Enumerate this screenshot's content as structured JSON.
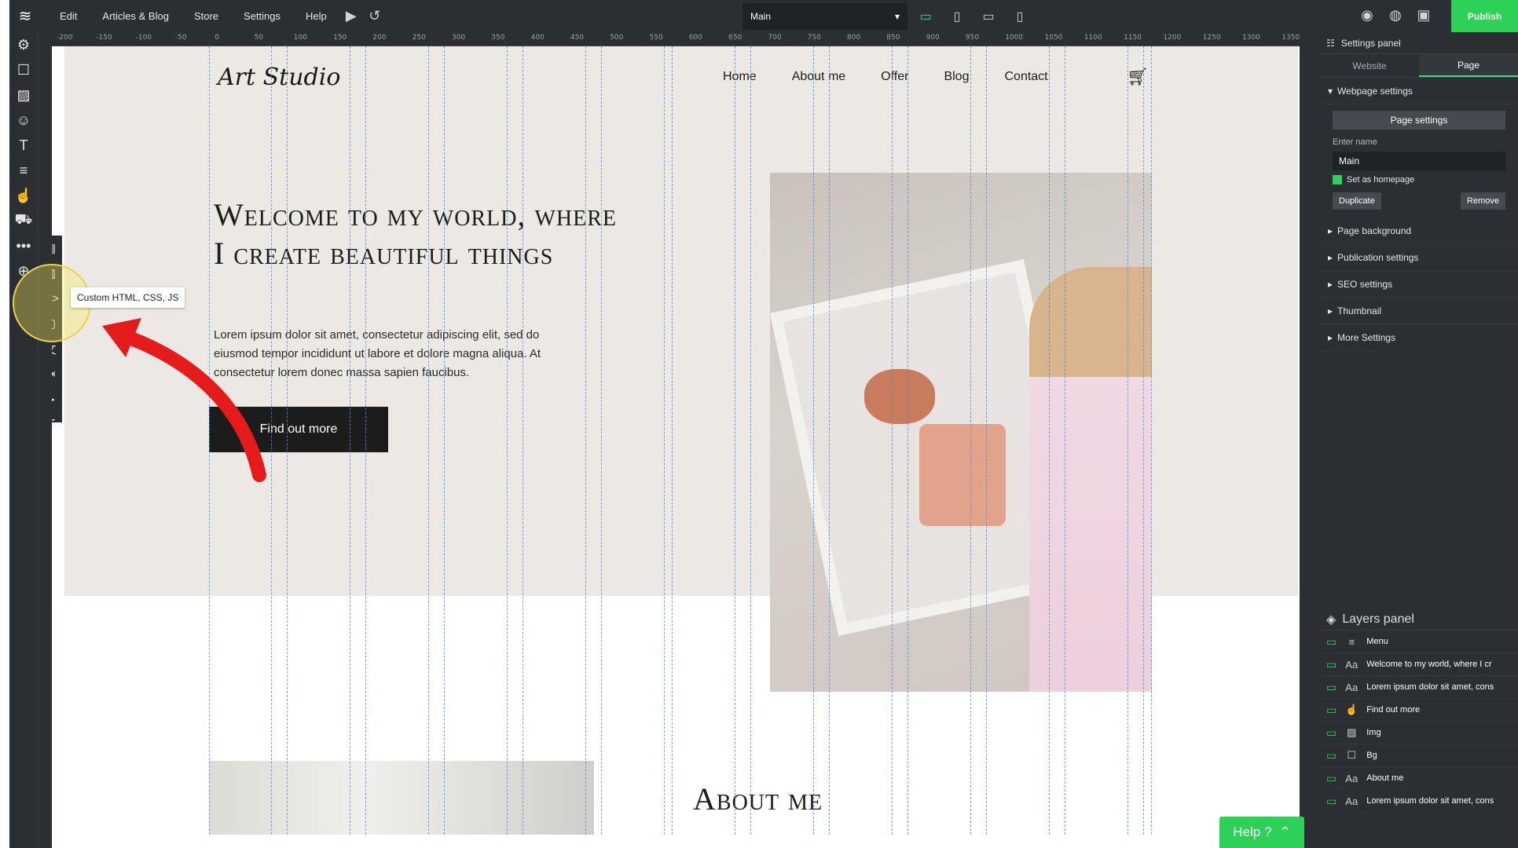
{
  "topbar": {
    "menu": [
      "Edit",
      "Articles & Blog",
      "Store",
      "Settings",
      "Help"
    ],
    "page_select": "Main",
    "publish_label": "Publish"
  },
  "ruler": {
    "ticks": [
      "-200",
      "-150",
      "-100",
      "-50",
      "0",
      "50",
      "100",
      "150",
      "200",
      "250",
      "300",
      "350",
      "400",
      "450",
      "500",
      "550",
      "600",
      "650",
      "700",
      "750",
      "800",
      "850",
      "900",
      "950",
      "1000",
      "1050",
      "1100",
      "1150",
      "1200",
      "1250",
      "1300",
      "1350"
    ]
  },
  "tooltip": "Custom HTML, CSS, JS",
  "site": {
    "logo": "Art Studio",
    "nav": [
      "Home",
      "About me",
      "Offer",
      "Blog",
      "Contact"
    ],
    "headline": "Welcome to my world, where I create beautiful things",
    "paragraph": "Lorem ipsum dolor sit amet, consectetur adipiscing elit, sed do eiusmod tempor incididunt ut labore et dolore magna aliqua. At consectetur lorem donec massa sapien faucibus.",
    "cta": "Find out more",
    "about_title": "About me"
  },
  "settings_panel": {
    "title": "Settings panel",
    "tabs": [
      "Website",
      "Page"
    ],
    "active_tab": "Page",
    "section_title": "Webpage settings",
    "page_settings_btn": "Page settings",
    "name_label": "Enter name",
    "name_value": "Main",
    "homepage_label": "Set as homepage",
    "duplicate": "Duplicate",
    "remove": "Remove",
    "sections": [
      "Page background",
      "Publication settings",
      "SEO settings",
      "Thumbnail",
      "More Settings"
    ]
  },
  "layers_panel": {
    "title": "Layers panel",
    "items": [
      {
        "type": "menu",
        "label": "Menu"
      },
      {
        "type": "text",
        "label": "Welcome to my world, where I cr"
      },
      {
        "type": "text",
        "label": "Lorem ipsum dolor sit amet, cons"
      },
      {
        "type": "button",
        "label": "Find out more"
      },
      {
        "type": "image",
        "label": "Img"
      },
      {
        "type": "box",
        "label": "Bg"
      },
      {
        "type": "text",
        "label": "About me"
      },
      {
        "type": "text",
        "label": "Lorem ipsum dolor sit amet, cons"
      }
    ]
  },
  "help": "Help ?",
  "colors": {
    "accent": "#2ed158",
    "dark": "#2b2f33",
    "hero_bg": "#ece9e4"
  }
}
